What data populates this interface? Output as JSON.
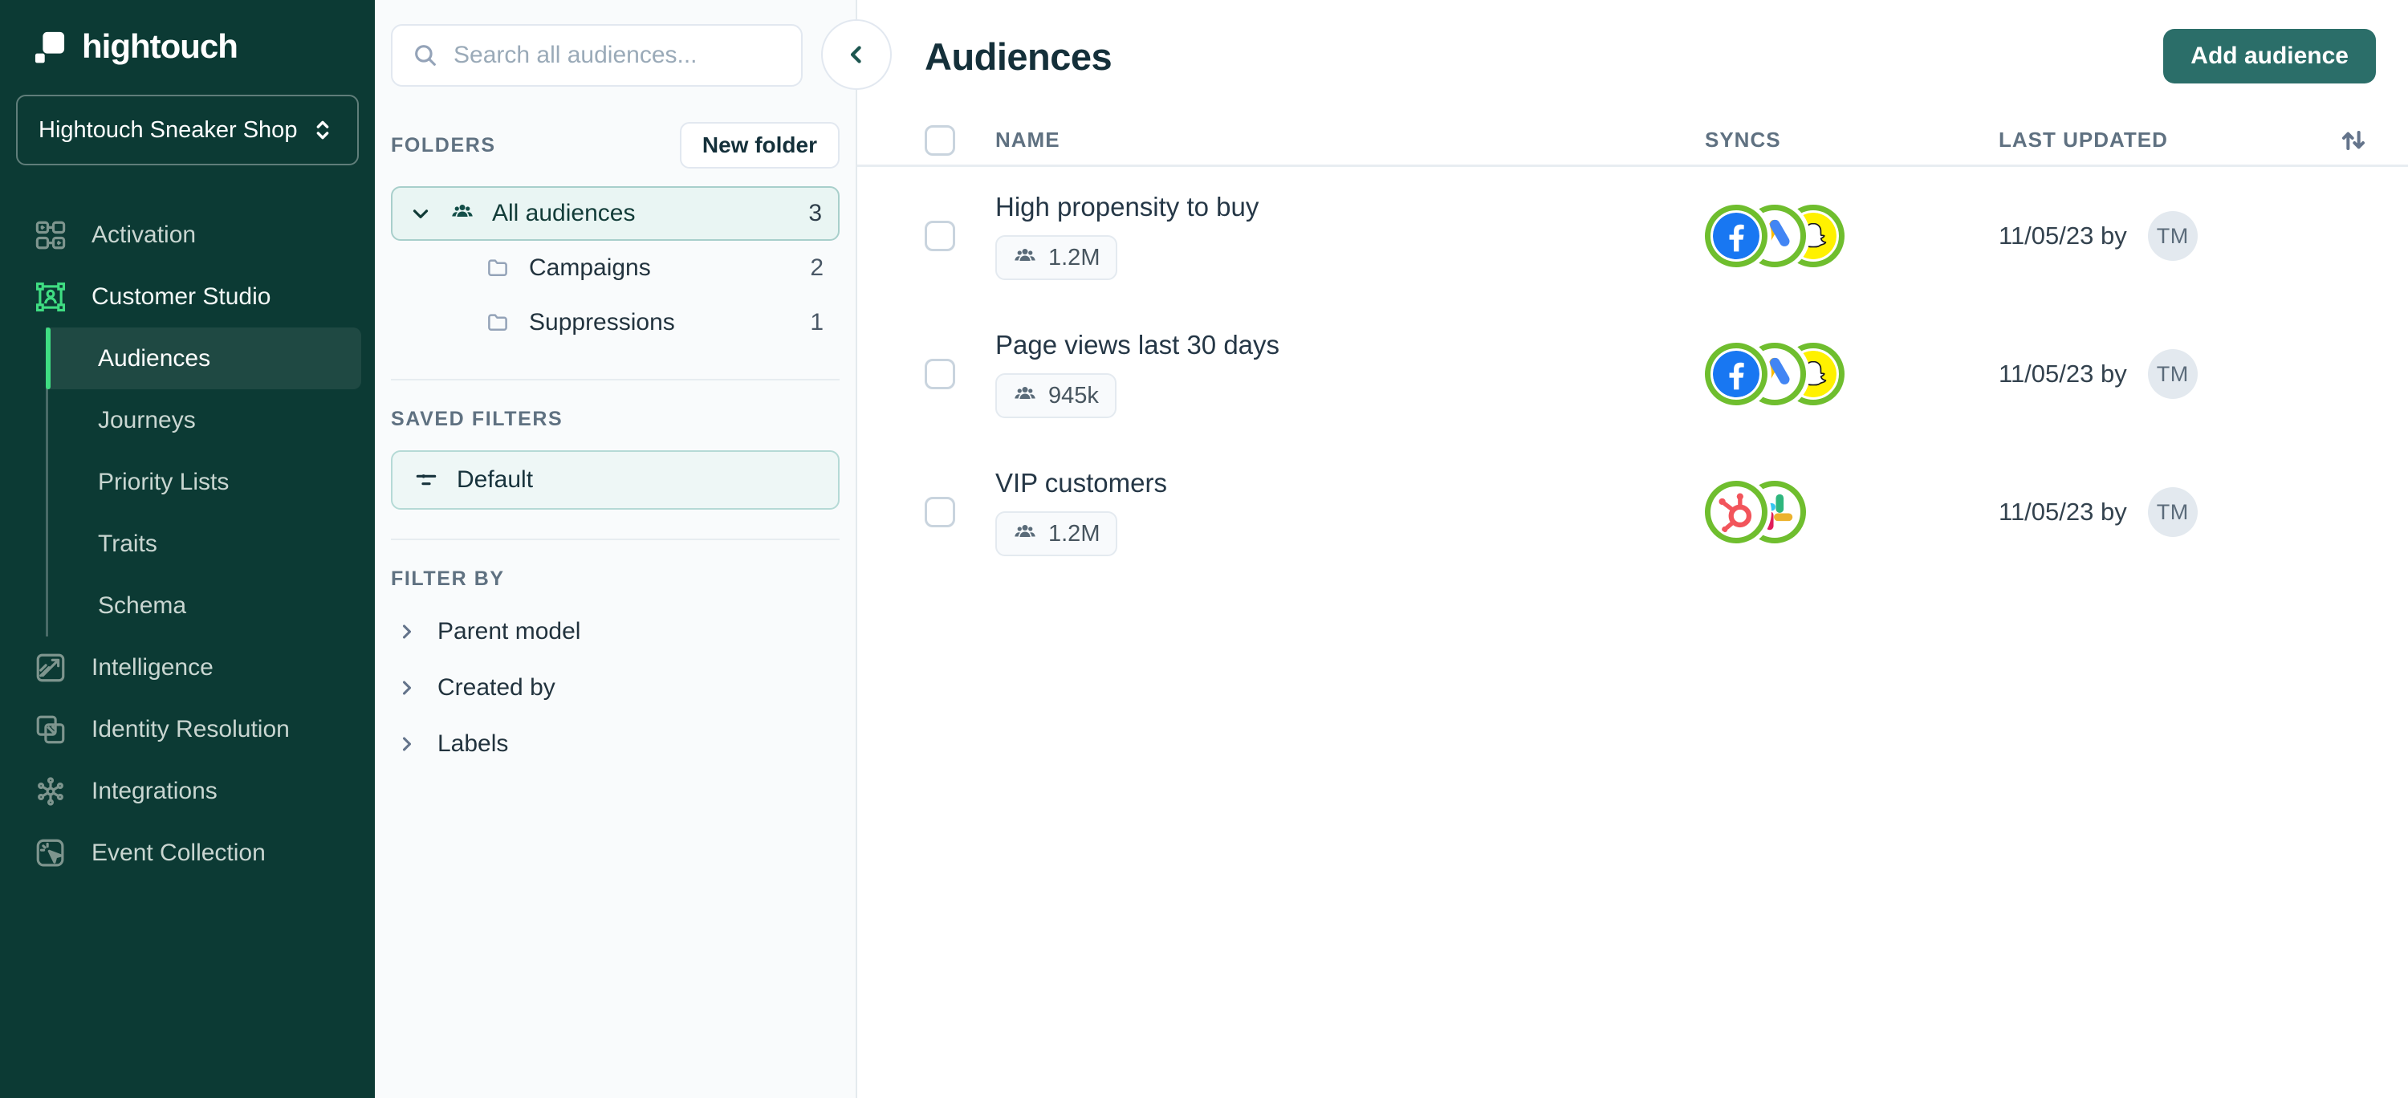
{
  "sidebar": {
    "logo_text": "hightouch",
    "workspace_name": "Hightouch Sneaker Shop",
    "items": {
      "activation": "Activation",
      "customer_studio": "Customer Studio",
      "audiences": "Audiences",
      "journeys": "Journeys",
      "priority_lists": "Priority Lists",
      "traits": "Traits",
      "schema": "Schema",
      "intelligence": "Intelligence",
      "identity_resolution": "Identity Resolution",
      "integrations": "Integrations",
      "event_collection": "Event Collection"
    },
    "active_item": "Audiences"
  },
  "folders_panel": {
    "search_placeholder": "Search all audiences...",
    "folders_label": "FOLDERS",
    "new_folder_button": "New folder",
    "tree": {
      "all_audiences": {
        "label": "All audiences",
        "count": "3",
        "expanded": true,
        "selected": true
      },
      "campaigns": {
        "label": "Campaigns",
        "count": "2"
      },
      "suppressions": {
        "label": "Suppressions",
        "count": "1"
      }
    },
    "saved_filters_label": "SAVED FILTERS",
    "saved_filters": {
      "default_label": "Default"
    },
    "filter_by_label": "FILTER BY",
    "filters": {
      "parent_model": "Parent model",
      "created_by": "Created by",
      "labels": "Labels"
    }
  },
  "main": {
    "title": "Audiences",
    "add_audience_button": "Add audience",
    "table": {
      "columns": {
        "name": "NAME",
        "syncs": "SYNCS",
        "last_updated": "LAST UPDATED"
      },
      "rows": [
        {
          "name": "High propensity to buy",
          "size": "1.2M",
          "syncs": [
            "facebook",
            "google-ads",
            "snapchat"
          ],
          "sync_status": "green",
          "last_updated": "11/05/23 by",
          "avatar": "TM"
        },
        {
          "name": "Page views last 30 days",
          "size": "945k",
          "syncs": [
            "facebook",
            "google-ads",
            "snapchat"
          ],
          "sync_status": "green",
          "last_updated": "11/05/23 by",
          "avatar": "TM"
        },
        {
          "name": "VIP customers",
          "size": "1.2M",
          "syncs": [
            "hubspot",
            "slack"
          ],
          "sync_status": "green",
          "last_updated": "11/05/23 by",
          "avatar": "TM"
        }
      ]
    }
  },
  "icons": {
    "search": "magnifier",
    "collapse": "chevron-left",
    "workspace": "chevron-up-down",
    "all_audiences": "people-group",
    "folder": "folder-outline",
    "saved_filter": "filter-lines",
    "filter_expand": "chevron-right",
    "sort": "arrows-up-down",
    "audience_size": "people-group"
  },
  "colors": {
    "sidebar_bg": "#0C3A34",
    "accent_green": "#3FDD82",
    "sync_ring_green": "#6FBE2E",
    "button_teal": "#2B6E69",
    "selected_teal_bg": "#E9F5F3",
    "selected_teal_border": "#A8CFCB",
    "facebook_blue": "#1877F2",
    "snapchat_yellow": "#FFF100",
    "hubspot_coral": "#F2545B",
    "slack_green": "#2EB67D",
    "slack_yellow": "#ECB22E",
    "slack_red": "#E01E5A",
    "slack_blue": "#36C5F0"
  }
}
